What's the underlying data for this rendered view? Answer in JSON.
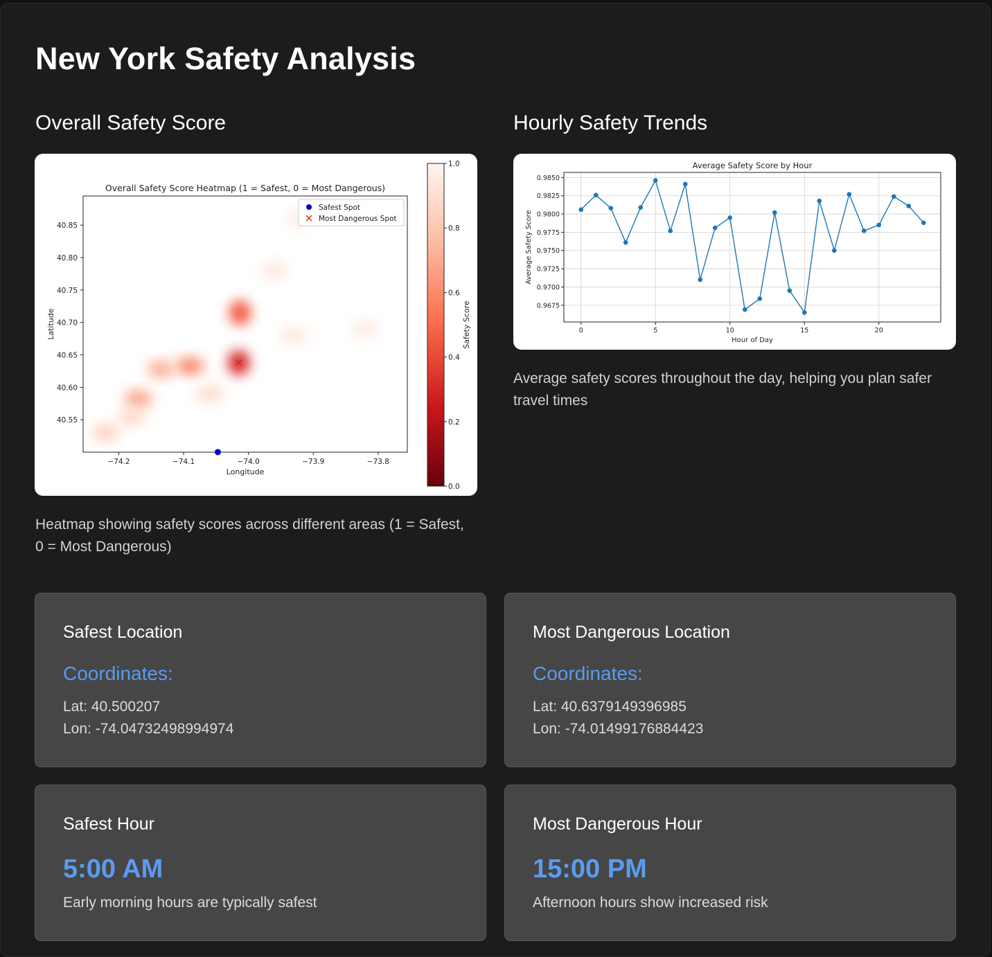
{
  "page": {
    "title": "New York Safety Analysis"
  },
  "heatmap_section": {
    "title": "Overall Safety Score",
    "caption": "Heatmap showing safety scores across different areas (1 = Safest, 0 = Most Dangerous)"
  },
  "trend_section": {
    "title": "Hourly Safety Trends",
    "caption": "Average safety scores throughout the day, helping you plan safer travel times"
  },
  "cards": {
    "safest_location": {
      "title": "Safest Location",
      "coord_label": "Coordinates:",
      "lat": "Lat: 40.500207",
      "lon": "Lon: -74.04732498994974"
    },
    "dangerous_location": {
      "title": "Most Dangerous Location",
      "coord_label": "Coordinates:",
      "lat": "Lat: 40.6379149396985",
      "lon": "Lon: -74.01499176884423"
    },
    "safest_hour": {
      "title": "Safest Hour",
      "value": "5:00 AM",
      "desc": "Early morning hours are typically safest"
    },
    "dangerous_hour": {
      "title": "Most Dangerous Hour",
      "value": "15:00 PM",
      "desc": "Afternoon hours show increased risk"
    }
  },
  "colors": {
    "accent": "#5b9bf0",
    "background": "#1c1c1c",
    "card": "#464646",
    "line": "#1f77b4",
    "danger": "#c8161c"
  },
  "chart_data": [
    {
      "type": "heatmap",
      "title": "Overall Safety Score Heatmap (1 = Safest, 0 = Most Dangerous)",
      "xlabel": "Longitude",
      "ylabel": "Latitude",
      "xlim": [
        -74.255,
        -73.755
      ],
      "ylim": [
        40.5,
        40.895
      ],
      "xticks": [
        -74.2,
        -74.1,
        -74.0,
        -73.9,
        -73.8
      ],
      "xtick_labels": [
        "−74.2",
        "−74.1",
        "−74.0",
        "−73.9",
        "−73.8"
      ],
      "yticks": [
        40.55,
        40.6,
        40.65,
        40.7,
        40.75,
        40.8,
        40.85
      ],
      "ytick_labels": [
        "40.55",
        "40.60",
        "40.65",
        "40.70",
        "40.75",
        "40.80",
        "40.85"
      ],
      "colorbar": {
        "label": "Safety Score",
        "range": [
          0.0,
          1.0
        ],
        "ticks": [
          0.0,
          0.2,
          0.4,
          0.6,
          0.8,
          1.0
        ],
        "tick_labels": [
          "0.0",
          "0.2",
          "0.4",
          "0.6",
          "0.8",
          "1.0"
        ],
        "colormap": "Reds_r"
      },
      "legend": {
        "position": "top-right",
        "entries": [
          "Safest Spot",
          "Most Dangerous Spot"
        ]
      },
      "markers": [
        {
          "name": "Safest Spot",
          "lon": -74.0473,
          "lat": 40.5002,
          "shape": "circle",
          "color": "#0000cc"
        },
        {
          "name": "Most Dangerous Spot",
          "lon": -74.015,
          "lat": 40.6379,
          "shape": "x",
          "color": "#e02020"
        }
      ],
      "hotspots": [
        {
          "lon": -74.015,
          "lat": 40.638,
          "score": 0.3
        },
        {
          "lon": -74.013,
          "lat": 40.715,
          "score": 0.45
        },
        {
          "lon": -74.09,
          "lat": 40.633,
          "score": 0.6
        },
        {
          "lon": -74.135,
          "lat": 40.628,
          "score": 0.72
        },
        {
          "lon": -74.17,
          "lat": 40.582,
          "score": 0.68
        },
        {
          "lon": -74.22,
          "lat": 40.53,
          "score": 0.86
        },
        {
          "lon": -74.18,
          "lat": 40.555,
          "score": 0.88
        },
        {
          "lon": -74.06,
          "lat": 40.59,
          "score": 0.9
        },
        {
          "lon": -73.96,
          "lat": 40.78,
          "score": 0.95
        },
        {
          "lon": -73.93,
          "lat": 40.68,
          "score": 0.95
        },
        {
          "lon": -73.82,
          "lat": 40.69,
          "score": 0.96
        },
        {
          "lon": -73.92,
          "lat": 40.86,
          "score": 0.97
        }
      ]
    },
    {
      "type": "line",
      "title": "Average Safety Score by Hour",
      "xlabel": "Hour of Day",
      "ylabel": "Average Safety Score",
      "xlim": [
        -1.15,
        24.15
      ],
      "ylim": [
        0.9652,
        0.9857
      ],
      "xticks": [
        0,
        5,
        10,
        15,
        20
      ],
      "xtick_labels": [
        "0",
        "5",
        "10",
        "15",
        "20"
      ],
      "yticks": [
        0.9675,
        0.97,
        0.9725,
        0.975,
        0.9775,
        0.98,
        0.9825,
        0.985
      ],
      "ytick_labels": [
        "0.9675",
        "0.9700",
        "0.9725",
        "0.9750",
        "0.9775",
        "0.9800",
        "0.9825",
        "0.9850"
      ],
      "grid": true,
      "series": [
        {
          "x": [
            0,
            1,
            2,
            3,
            4,
            5,
            6,
            7,
            8,
            9,
            10,
            11,
            12,
            13,
            14,
            15,
            16,
            17,
            18,
            19,
            20,
            21,
            22,
            23
          ],
          "values": [
            0.9806,
            0.9826,
            0.9808,
            0.9761,
            0.9809,
            0.9846,
            0.9777,
            0.9841,
            0.971,
            0.9781,
            0.9795,
            0.9669,
            0.9684,
            0.9802,
            0.9695,
            0.9665,
            0.9818,
            0.975,
            0.9827,
            0.9777,
            0.9785,
            0.9824,
            0.9811,
            0.9788
          ]
        }
      ]
    }
  ]
}
